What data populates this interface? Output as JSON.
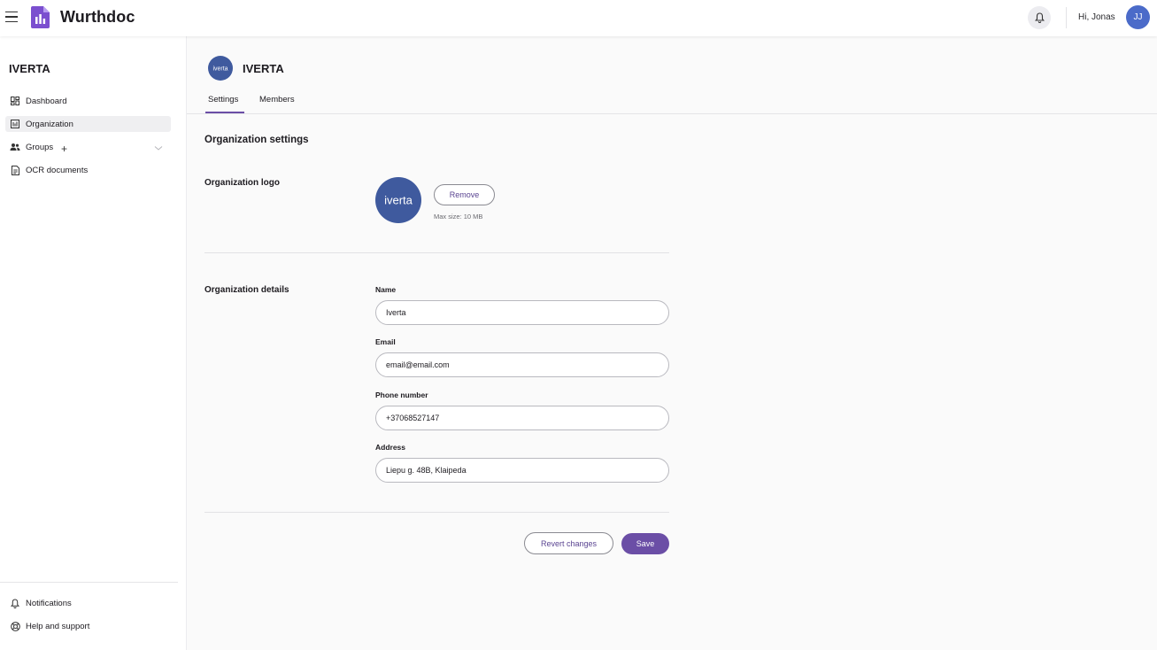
{
  "app": {
    "name": "Wurthdoc"
  },
  "topbar": {
    "greeting": "Hi, Jonas",
    "avatar_initials": "JJ"
  },
  "sidebar": {
    "org_name": "IVERTA",
    "items": [
      {
        "label": "Dashboard",
        "icon": "dashboard-icon"
      },
      {
        "label": "Organization",
        "icon": "organization-icon",
        "active": true
      },
      {
        "label": "Groups",
        "icon": "groups-icon"
      },
      {
        "label": "OCR documents",
        "icon": "document-icon"
      }
    ],
    "footer": [
      {
        "label": "Notifications",
        "icon": "bell-icon"
      },
      {
        "label": "Help and support",
        "icon": "help-icon"
      }
    ]
  },
  "main": {
    "title": "IVERTA",
    "logo_text": "iverta",
    "tabs": [
      {
        "label": "Settings",
        "active": true
      },
      {
        "label": "Members"
      }
    ],
    "section_title": "Organization settings",
    "logo_section": {
      "label": "Organization logo",
      "remove_label": "Remove",
      "max_size": "Max size: 10 MB"
    },
    "details": {
      "label": "Organization details",
      "fields": [
        {
          "label": "Name",
          "value": "Iverta"
        },
        {
          "label": "Email",
          "value": "email@email.com"
        },
        {
          "label": "Phone number",
          "value": "+37068527147"
        },
        {
          "label": "Address",
          "value": "Liepu g. 48B, Klaipeda"
        }
      ]
    },
    "actions": {
      "revert_label": "Revert changes",
      "save_label": "Save"
    }
  },
  "colors": {
    "accent": "#6b4ea6",
    "logo_bg": "#3f5a9e",
    "avatar_bg": "#4b6bc9"
  }
}
